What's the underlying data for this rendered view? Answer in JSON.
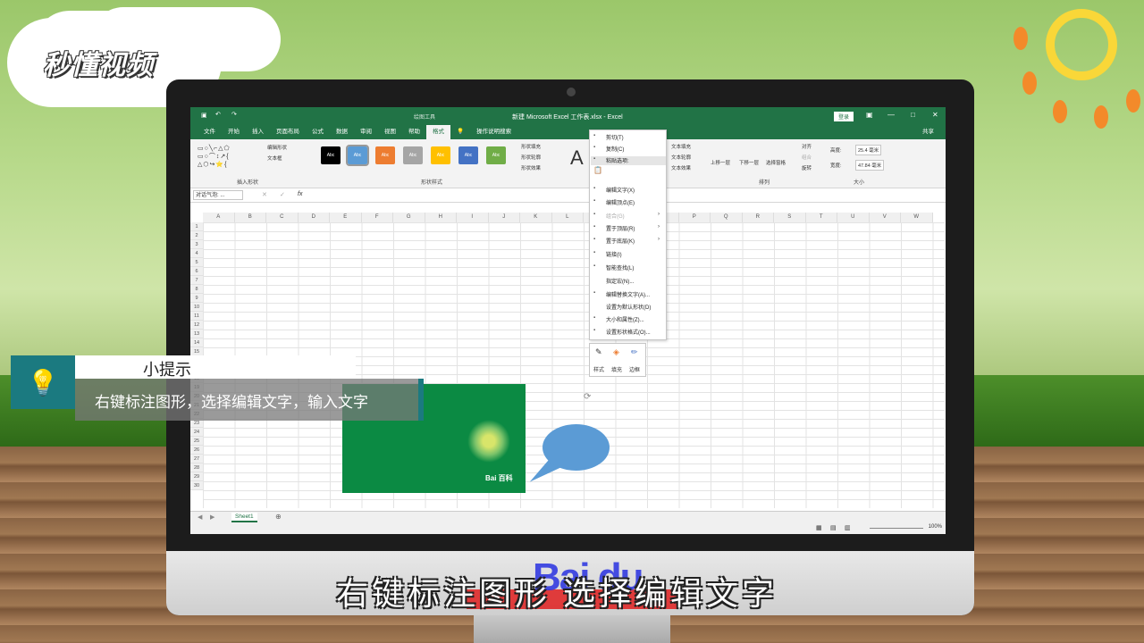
{
  "brand": {
    "logo_text": "秒懂视频"
  },
  "excel": {
    "window_title": "新建 Microsoft Excel 工作表.xlsx - Excel",
    "context_tab": "绘图工具",
    "login_button": "登录",
    "share_label": "共享",
    "menu_tabs": [
      "文件",
      "开始",
      "插入",
      "页面布局",
      "公式",
      "数据",
      "审阅",
      "视图",
      "帮助",
      "格式"
    ],
    "active_tab": "格式",
    "search_hint": "操作说明搜索",
    "ribbon": {
      "insert_shapes_label": "插入形状",
      "edit_shape": "编辑形状",
      "text_box": "文本框",
      "shape_styles_label": "形状样式",
      "style_swatch_text": "Abc",
      "shape_fill": "形状填充",
      "shape_outline": "形状轮廓",
      "shape_effects": "形状效果",
      "text_fill": "文本填充",
      "text_outline": "文本轮廓",
      "text_effects": "文本效果",
      "bring_forward": "上移一层",
      "send_backward": "下移一层",
      "selection_pane": "选择窗格",
      "align": "对齐",
      "group": "组合",
      "rotate": "旋转",
      "arrange_label": "排列",
      "height_label": "高度:",
      "height_value": "25.4 毫米",
      "width_label": "宽度:",
      "width_value": "47.84 毫米",
      "size_label": "大小"
    },
    "name_box": "对话气泡: ...",
    "fx": "fx",
    "columns": [
      "A",
      "B",
      "C",
      "D",
      "E",
      "F",
      "G",
      "H",
      "I",
      "J",
      "K",
      "L",
      "M",
      "N",
      "O",
      "P",
      "Q",
      "R",
      "S",
      "T",
      "U",
      "V",
      "W"
    ],
    "rows": [
      "1",
      "2",
      "3",
      "4",
      "5",
      "6",
      "7",
      "8",
      "9",
      "10",
      "11",
      "12",
      "13",
      "14",
      "15",
      "16",
      "17",
      "18",
      "19",
      "20",
      "21",
      "22",
      "23",
      "24",
      "25",
      "26",
      "27",
      "28",
      "29",
      "30"
    ],
    "sheet_tab": "Sheet1",
    "zoom": "100%",
    "image_label": "Bai 百科",
    "context_menu": {
      "items": [
        {
          "label": "剪切(T)",
          "icon": "scissors-icon",
          "disabled": false
        },
        {
          "label": "复制(C)",
          "icon": "copy-icon",
          "disabled": false
        },
        {
          "label": "粘贴选项:",
          "icon": "paste-icon",
          "disabled": false
        },
        {
          "label": "编辑文字(X)",
          "icon": "edit-text-icon",
          "disabled": false
        },
        {
          "label": "编辑顶点(E)",
          "icon": "edit-points-icon",
          "disabled": false
        },
        {
          "label": "组合(G)",
          "icon": "group-icon",
          "disabled": true
        },
        {
          "label": "置于顶层(R)",
          "icon": "bring-front-icon",
          "disabled": false
        },
        {
          "label": "置于底层(K)",
          "icon": "send-back-icon",
          "disabled": false
        },
        {
          "label": "链接(I)",
          "icon": "link-icon",
          "disabled": false
        },
        {
          "label": "智能查找(L)",
          "icon": "smart-lookup-icon",
          "disabled": false
        },
        {
          "label": "指定宏(N)...",
          "icon": "",
          "disabled": false
        },
        {
          "label": "编辑替换文字(A)...",
          "icon": "alt-text-icon",
          "disabled": false
        },
        {
          "label": "设置为默认形状(D)",
          "icon": "",
          "disabled": false
        },
        {
          "label": "大小和属性(Z)...",
          "icon": "size-icon",
          "disabled": false
        },
        {
          "label": "设置形状格式(O)...",
          "icon": "format-shape-icon",
          "disabled": false
        }
      ]
    },
    "mini_toolbar": {
      "style": "样式",
      "fill": "填充",
      "border": "边框"
    }
  },
  "tip": {
    "heading": "小提示",
    "body": "右键标注图形，选择编辑文字，输入文字"
  },
  "subtitle": "右键标注图形 选择编辑文字",
  "watermark": "Bai du",
  "colors": {
    "excel_green": "#217346",
    "tip_teal": "#1b7a80"
  }
}
